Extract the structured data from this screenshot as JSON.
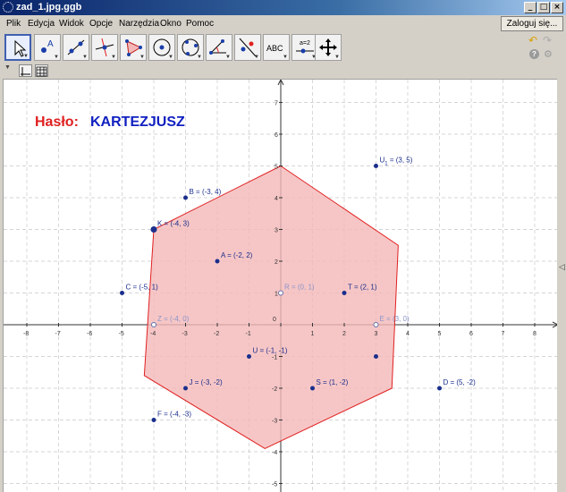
{
  "window": {
    "title": "zad_1.jpg.ggb",
    "buttons": {
      "minimize": "_",
      "maximize": "□",
      "close": "×"
    }
  },
  "menu": {
    "items": [
      "Plik",
      "Edycja",
      "Widok",
      "Opcje",
      "Narzędzia",
      "Okno",
      "Pomoc"
    ],
    "login": "Zaloguj się..."
  },
  "toolbar": {
    "tools": [
      {
        "name": "move-tool-icon",
        "selected": true
      },
      {
        "name": "point-tool-icon",
        "label": "A"
      },
      {
        "name": "line-tool-icon"
      },
      {
        "name": "perpendicular-line-tool-icon"
      },
      {
        "name": "polygon-tool-icon"
      },
      {
        "name": "circle-tool-icon"
      },
      {
        "name": "conic-tool-icon"
      },
      {
        "name": "angle-tool-icon"
      },
      {
        "name": "reflect-tool-icon"
      },
      {
        "name": "text-tool-icon",
        "label": "ABC"
      },
      {
        "name": "slider-tool-icon",
        "label": "a=2"
      },
      {
        "name": "move-view-tool-icon"
      }
    ]
  },
  "graphics": {
    "axes": {
      "x_ticks": [
        "-8",
        "-7",
        "-6",
        "-5",
        "-4",
        "-3",
        "-2",
        "-1",
        "0",
        "1",
        "2",
        "3",
        "4",
        "5",
        "6",
        "7",
        "8"
      ],
      "y_ticks_pos": [
        "1",
        "2",
        "3",
        "4",
        "5",
        "6",
        "7"
      ],
      "y_ticks_neg": [
        "-1",
        "-2",
        "-3",
        "-4",
        "-5"
      ]
    },
    "haslo_label": "Hasło:",
    "haslo_value": "KARTEZJUSZ",
    "haslo_label_color": "#e02020",
    "haslo_value_color": "#1020c0",
    "polygon": {
      "vertices": [
        [
          0,
          5
        ],
        [
          3.7,
          2.5
        ],
        [
          3.5,
          -2
        ],
        [
          -0.5,
          -3.9
        ],
        [
          -4.3,
          -1.6
        ],
        [
          -4,
          3
        ]
      ],
      "fill": "#f4b8b8",
      "stroke": "#e02020"
    },
    "points": [
      {
        "label": "U",
        "sub": "1",
        "rest": " = (3, 5)",
        "x": 3,
        "y": 5
      },
      {
        "label": "B = (-3, 4)",
        "x": -3,
        "y": 4
      },
      {
        "label": "K = (-4, 3)",
        "x": -4,
        "y": 3
      },
      {
        "label": "A = (-2, 2)",
        "x": -2,
        "y": 2
      },
      {
        "label": "C = (-5, 1)",
        "x": -5,
        "y": 1
      },
      {
        "label": "T = (2, 1)",
        "x": 2,
        "y": 1
      },
      {
        "label": "R = (0, 1)",
        "x": 0,
        "y": 1,
        "hollow": true
      },
      {
        "label": "Z = (-4, 0)",
        "x": -4,
        "y": 0,
        "hollow": true
      },
      {
        "label": "E = (3, 0)",
        "x": 3,
        "y": 0,
        "hollow": true
      },
      {
        "label": "U = (-1, -1)",
        "x": -1,
        "y": -1
      },
      {
        "label": "",
        "x": 3,
        "y": -1
      },
      {
        "label": "J = (-3, -2)",
        "x": -3,
        "y": -2
      },
      {
        "label": "S = (1, -2)",
        "x": 1,
        "y": -2
      },
      {
        "label": "D = (5, -2)",
        "x": 5,
        "y": -2
      },
      {
        "label": "F = (-4, -3)",
        "x": -4,
        "y": -3
      }
    ]
  }
}
